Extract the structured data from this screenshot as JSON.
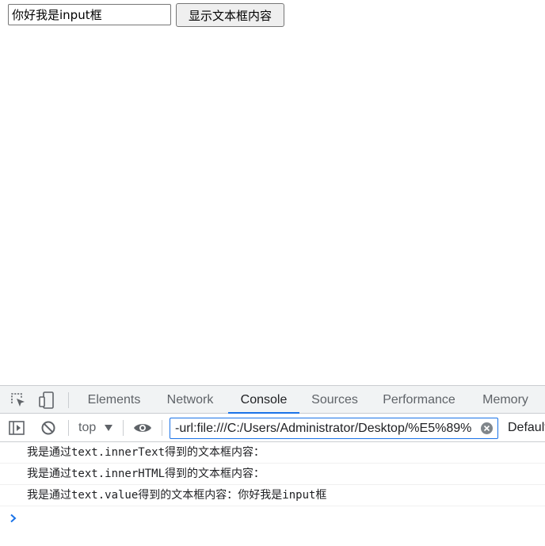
{
  "page": {
    "input_value": "你好我是input框",
    "button_label": "显示文本框内容"
  },
  "devtools": {
    "tabs": [
      "Elements",
      "Network",
      "Console",
      "Sources",
      "Performance",
      "Memory"
    ],
    "active_tab": "Console",
    "toolbar": {
      "context": "top",
      "filter_value": "-url:file:///C:/Users/Administrator/Desktop/%E5%89%",
      "levels": "Default"
    },
    "console_lines": [
      "我是通过text.innerText得到的文本框内容：",
      "我是通过text.innerHTML得到的文本框内容：",
      "我是通过text.value得到的文本框内容：你好我是input框"
    ],
    "icons": [
      "inspect-element-icon",
      "device-toolbar-icon",
      "sidebar-toggle-icon",
      "clear-console-icon",
      "dropdown-triangle-icon",
      "eye-icon",
      "clear-filter-icon",
      "console-prompt-icon"
    ],
    "accent_color": "#1a73e8"
  }
}
